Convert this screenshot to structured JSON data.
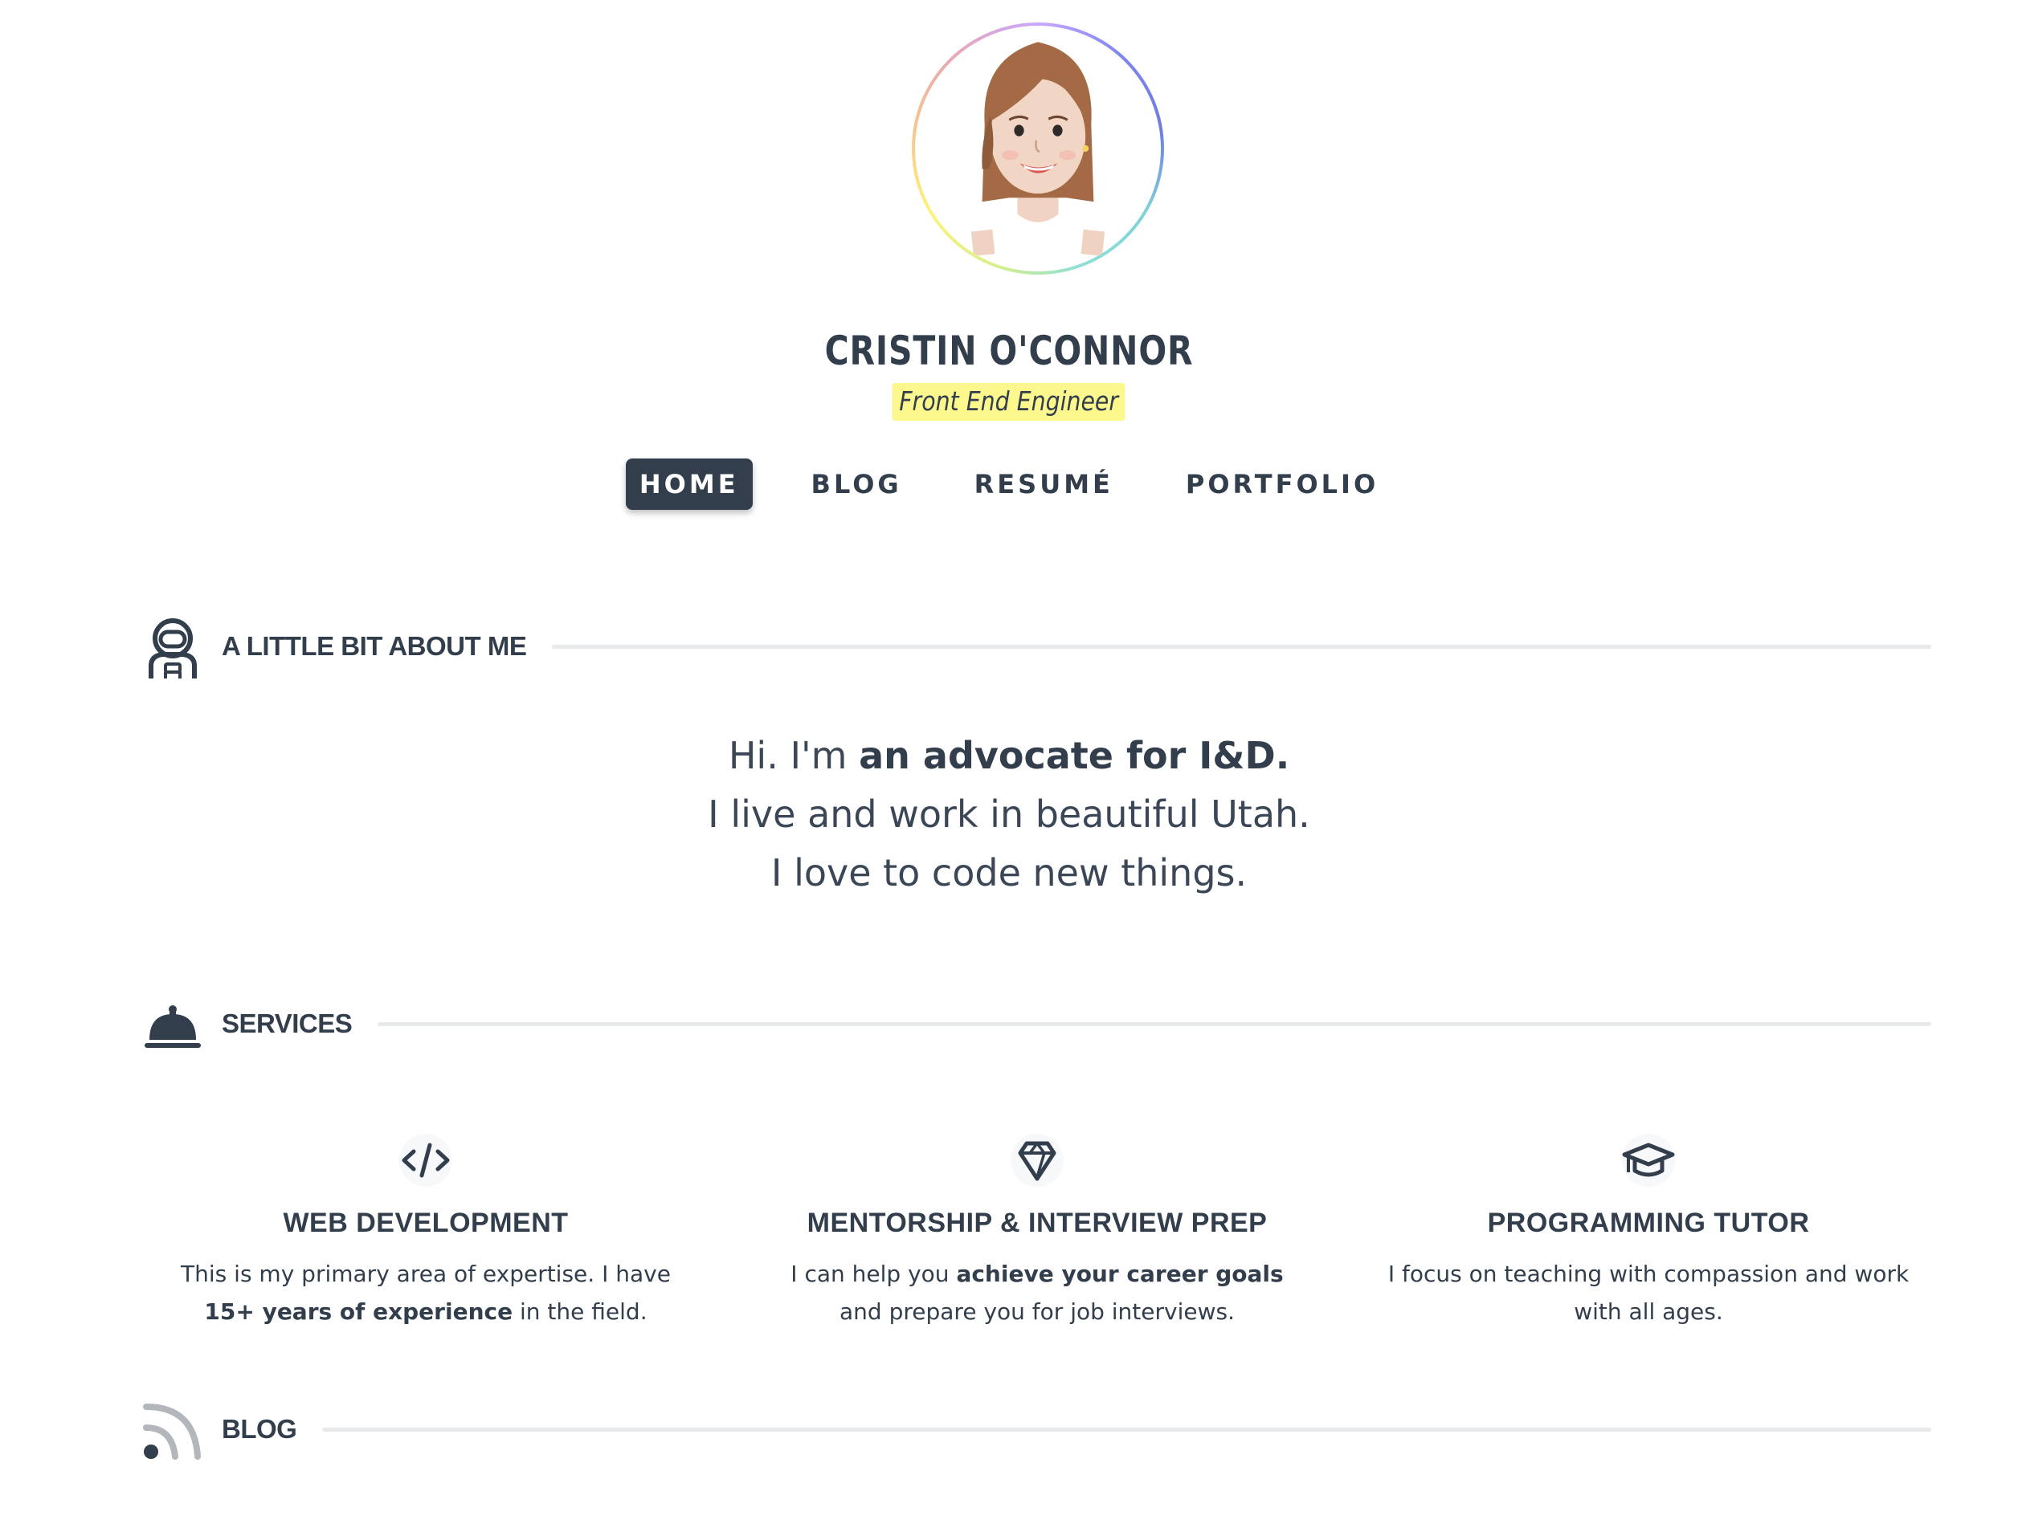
{
  "profile": {
    "name": "CRISTIN O'CONNOR",
    "role": "Front End Engineer"
  },
  "nav": {
    "items": [
      {
        "label": "HOME",
        "active": true
      },
      {
        "label": "BLOG",
        "active": false
      },
      {
        "label": "RESUMÉ",
        "active": false
      },
      {
        "label": "PORTFOLIO",
        "active": false
      }
    ]
  },
  "about": {
    "heading": "A LITTLE BIT ABOUT ME",
    "icon": "astronaut-icon",
    "line1_prefix": "Hi. I'm ",
    "line1_bold": "an advocate for I&D.",
    "line2": "I live and work in beautiful Utah.",
    "line3": "I love to code new things."
  },
  "services": {
    "heading": "SERVICES",
    "icon": "concierge-bell-icon",
    "items": [
      {
        "icon": "code-icon",
        "title": "WEB DEVELOPMENT",
        "desc_a": "This is my primary area of expertise. I have ",
        "desc_bold": "15+ years of experience",
        "desc_b": " in the field."
      },
      {
        "icon": "gem-icon",
        "title": "MENTORSHIP & INTERVIEW PREP",
        "desc_a": "I can help you ",
        "desc_bold": "achieve your career goals",
        "desc_b": " and prepare you for job interviews."
      },
      {
        "icon": "graduation-cap-icon",
        "title": "PROGRAMMING TUTOR",
        "desc_a": "I focus on teaching with compassion and work with all ages.",
        "desc_bold": "",
        "desc_b": ""
      }
    ]
  },
  "blog": {
    "heading": "BLOG",
    "icon": "rss-icon"
  },
  "colors": {
    "text": "#323e4c",
    "highlight": "#fcf88e",
    "divider": "#e8e9ea",
    "nav_active_bg": "#323e4c"
  }
}
